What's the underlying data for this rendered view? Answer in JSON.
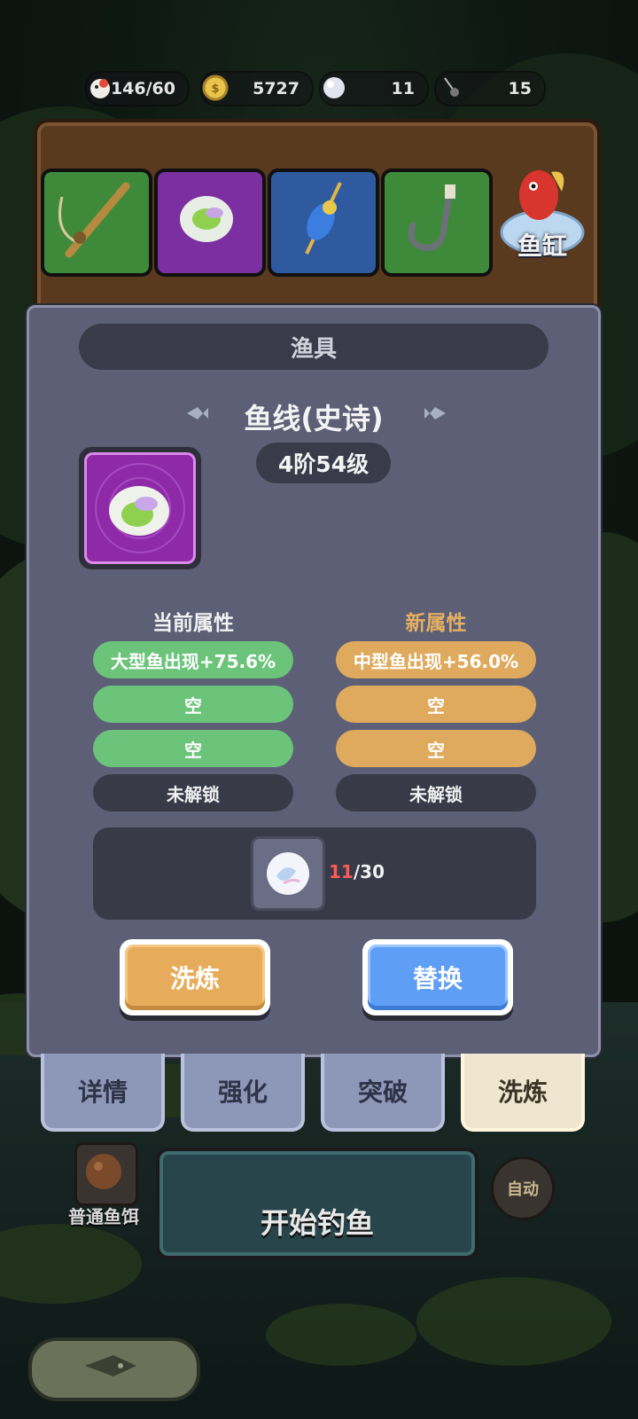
{
  "resources": [
    {
      "name": "stamina",
      "icon": "chicken-icon",
      "value": "146/60"
    },
    {
      "name": "coins",
      "icon": "coin-icon",
      "value": "5727"
    },
    {
      "name": "pearls",
      "icon": "pearl-icon",
      "value": "11"
    },
    {
      "name": "bait",
      "icon": "fishing-hook-icon",
      "value": "15"
    }
  ],
  "equipment_slots": [
    {
      "name": "fishing-rod",
      "icon": "fishing-rod-icon",
      "color": "#3f8a3a"
    },
    {
      "name": "fishing-line",
      "icon": "reel-icon",
      "color": "#7b2fa0"
    },
    {
      "name": "float",
      "icon": "float-icon",
      "color": "#2f5aa0"
    },
    {
      "name": "hook",
      "icon": "hook-icon",
      "color": "#3f8a3a"
    }
  ],
  "fish_tank": {
    "label": "鱼缸"
  },
  "panel": {
    "header": "渔具",
    "item_name": "鱼线(史诗)",
    "level": "4阶54级",
    "current_title": "当前属性",
    "new_title": "新属性",
    "current_attrs": [
      "大型鱼出现+75.6%",
      "空",
      "空",
      "未解锁"
    ],
    "new_attrs": [
      "中型鱼出现+56.0%",
      "空",
      "空",
      "未解锁"
    ],
    "cost": {
      "have": "11",
      "need": "/30"
    },
    "refine_button": "洗炼",
    "replace_button": "替换"
  },
  "tabs": [
    {
      "label": "详情",
      "active": false
    },
    {
      "label": "强化",
      "active": false
    },
    {
      "label": "突破",
      "active": false
    },
    {
      "label": "洗炼",
      "active": true
    }
  ],
  "bottom": {
    "bait_label": "普通鱼饵",
    "start_fishing": "开始钓鱼",
    "auto": "自动"
  },
  "colors": {
    "current_attr_green": "#6cc47b",
    "new_attr_orange": "#e0aa5e",
    "new_title": "#e6b062",
    "epic_purple": "#8e2aa8",
    "cost_have_red": "#ff5a5a"
  }
}
